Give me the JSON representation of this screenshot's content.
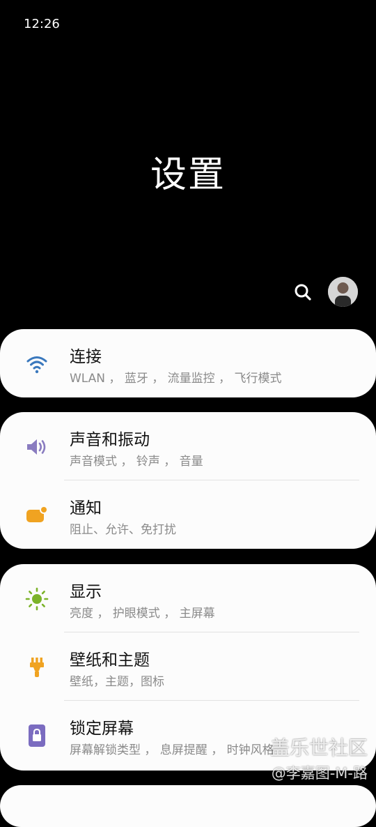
{
  "status_bar": {
    "time": "12:26"
  },
  "page_title": "设置",
  "groups": [
    {
      "items": [
        {
          "title": "连接",
          "subtitle": "WLAN ， 蓝牙 ， 流量监控 ， 飞行模式",
          "icon": "wifi-icon",
          "color": "#3a78bd"
        }
      ]
    },
    {
      "items": [
        {
          "title": "声音和振动",
          "subtitle": "声音模式 ， 铃声 ， 音量",
          "icon": "speaker-icon",
          "color": "#8a7cc0"
        },
        {
          "title": "通知",
          "subtitle": "阻止、允许、免打扰",
          "icon": "notification-icon",
          "color": "#f0a321"
        }
      ]
    },
    {
      "items": [
        {
          "title": "显示",
          "subtitle": "亮度 ， 护眼模式 ， 主屏幕",
          "icon": "brightness-icon",
          "color": "#7cb32a"
        },
        {
          "title": "壁纸和主题",
          "subtitle": "壁纸，主题，图标",
          "icon": "paint-brush-icon",
          "color": "#f0a321"
        },
        {
          "title": "锁定屏幕",
          "subtitle": "屏幕解锁类型 ， 息屏提醒 ， 时钟风格",
          "icon": "lock-icon",
          "color": "#7b6cc0"
        }
      ]
    }
  ],
  "watermark": {
    "line1": "盖乐世社区",
    "line2": "@李嘉图-M-路"
  }
}
